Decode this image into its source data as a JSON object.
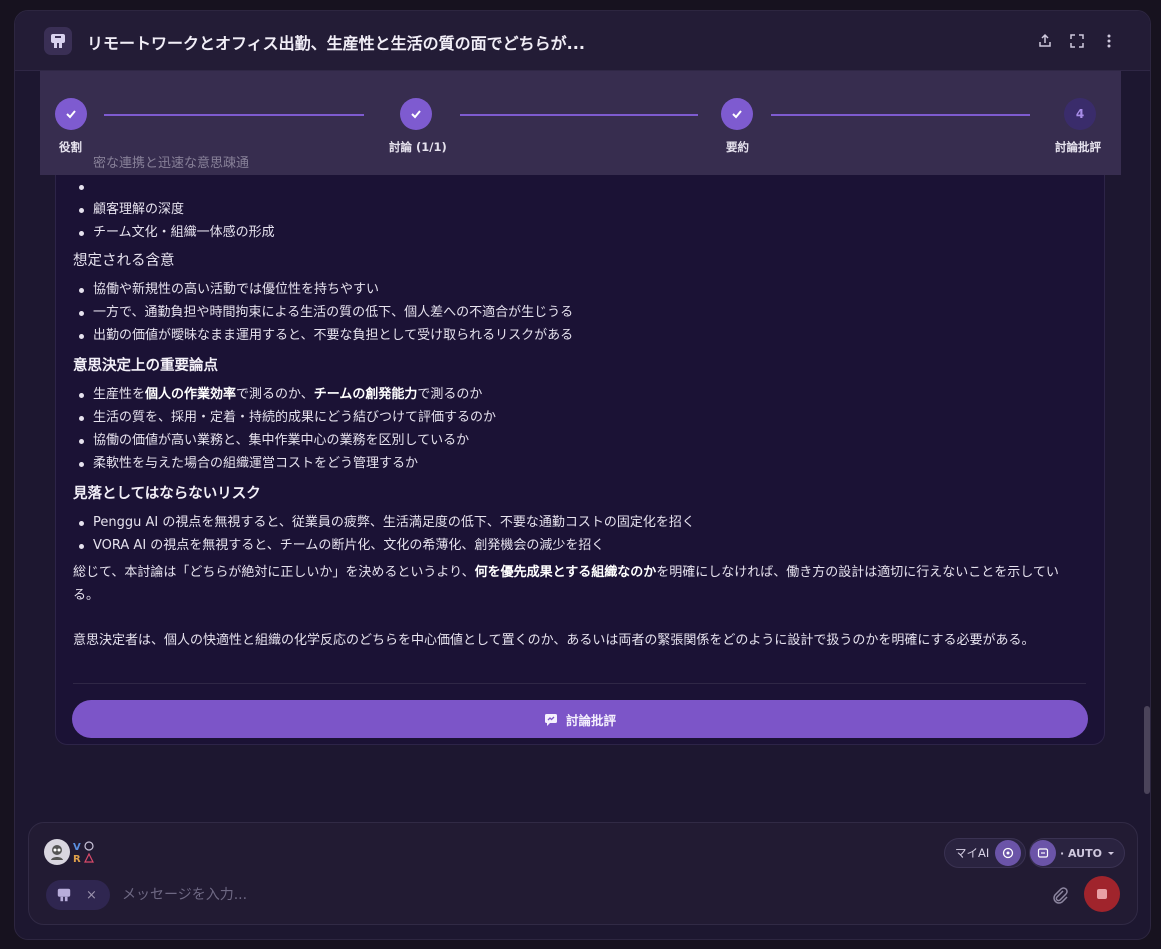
{
  "header": {
    "title": "リモートワークとオフィス出勤、生産性と生活の質の面でどちらが...",
    "actions": [
      "share-icon",
      "expand-icon",
      "more-icon"
    ]
  },
  "stepper": {
    "steps": [
      {
        "label": "役割",
        "state": "done"
      },
      {
        "label": "討論 (1/1)",
        "state": "done"
      },
      {
        "label": "要約",
        "state": "done"
      },
      {
        "label": "討論批評",
        "state": "pending",
        "number": "4"
      }
    ]
  },
  "content": {
    "partial_bullets": [
      "密な連携と迅速な意思疎通",
      "顧客理解の深度",
      "チーム文化・組織一体感の形成"
    ],
    "implications_heading": "想定される含意",
    "implications": [
      "協働や新規性の高い活動では優位性を持ちやすい",
      "一方で、通勤負担や時間拘束による生活の質の低下、個人差への不適合が生じうる",
      "出勤の価値が曖昧なまま運用すると、不要な負担として受け取られるリスクがある"
    ],
    "decision_heading": "意思決定上の重要論点",
    "decision_points": [
      {
        "pre": "生産性を",
        "b1": "個人の作業効率",
        "mid": "で測るのか、",
        "b2": "チームの創発能力",
        "post": "で測るのか"
      },
      {
        "text": "生活の質を、採用・定着・持続的成果にどう結びつけて評価するのか"
      },
      {
        "text": "協働の価値が高い業務と、集中作業中心の業務を区別しているか"
      },
      {
        "text": "柔軟性を与えた場合の組織運営コストをどう管理するか"
      }
    ],
    "risk_heading": "見落としてはならないリスク",
    "risks": [
      "Penggu AI の視点を無視すると、従業員の疲弊、生活満足度の低下、不要な通勤コストの固定化を招く",
      "VORA AI の視点を無視すると、チームの断片化、文化の希薄化、創発機会の減少を招く"
    ],
    "summary_pre": "総じて、本討論は「どちらが絶対に正しいか」を決めるというより、",
    "summary_bold": "何を優先成果とする組織なのか",
    "summary_post": "を明確にしなければ、働き方の設計は適切に行えないことを示している。",
    "closing": "意思決定者は、個人の快適性と組織の化学反応のどちらを中心価値として置くのか、あるいは両者の緊張関係をどのように設計で扱うのかを明確にする必要がある。"
  },
  "critique_button": {
    "label": "討論批評"
  },
  "composer": {
    "avatar2_text": "VO RA",
    "my_ai_label": "マイAI",
    "auto_label": "· AUTO",
    "placeholder": "メッセージを入力...",
    "chip_remove": "×"
  },
  "colors": {
    "accent": "#7c55c8",
    "stop": "#a0242c",
    "background": "#1d1730"
  }
}
